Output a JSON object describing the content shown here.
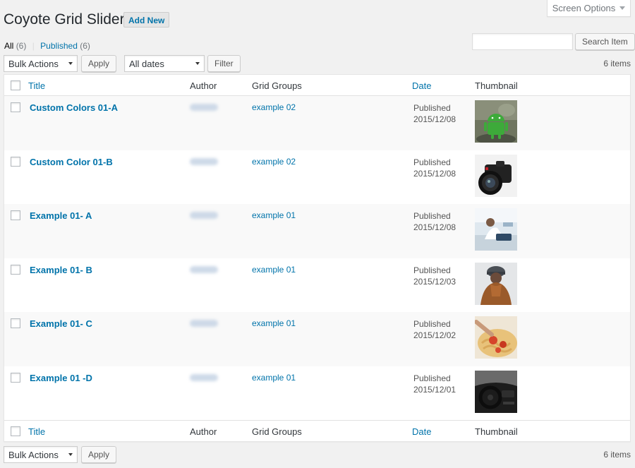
{
  "header": {
    "title": "Coyote Grid Slider",
    "add_new": "Add New",
    "screen_options": "Screen Options"
  },
  "views": {
    "all_label": "All",
    "all_count": "(6)",
    "separator": "|",
    "published_label": "Published",
    "published_count": "(6)"
  },
  "search": {
    "placeholder": "",
    "button": "Search Item"
  },
  "tablenav": {
    "bulk_actions": "Bulk Actions",
    "apply": "Apply",
    "all_dates": "All dates",
    "filter": "Filter",
    "items": "6 items"
  },
  "columns": {
    "title": "Title",
    "author": "Author",
    "groups": "Grid Groups",
    "date": "Date",
    "thumbnail": "Thumbnail"
  },
  "rows": [
    {
      "title": "Custom Colors 01-A",
      "group": "example 02",
      "status": "Published",
      "date": "2015/12/08",
      "thumb": "android-icon"
    },
    {
      "title": "Custom Color 01-B",
      "group": "example 02",
      "status": "Published",
      "date": "2015/12/08",
      "thumb": "camera-icon"
    },
    {
      "title": "Example 01- A",
      "group": "example 01",
      "status": "Published",
      "date": "2015/12/08",
      "thumb": "office-woman-photo"
    },
    {
      "title": "Example 01- B",
      "group": "example 01",
      "status": "Published",
      "date": "2015/12/03",
      "thumb": "hooded-person-photo"
    },
    {
      "title": "Example 01- C",
      "group": "example 01",
      "status": "Published",
      "date": "2015/12/02",
      "thumb": "pasta-photo"
    },
    {
      "title": "Example 01 -D",
      "group": "example 01",
      "status": "Published",
      "date": "2015/12/01",
      "thumb": "car-interior-photo"
    }
  ],
  "colors": {
    "link": "#0073aa",
    "background": "#f1f1f1",
    "row_alt": "#f9f9f9"
  }
}
